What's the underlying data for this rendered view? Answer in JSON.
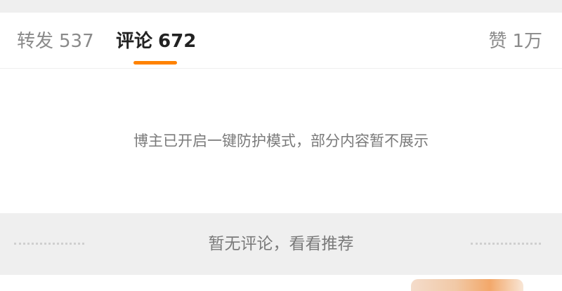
{
  "tabs": {
    "repost": {
      "label": "转发",
      "count": "537"
    },
    "comments": {
      "label": "评论",
      "count": "672"
    },
    "likes": {
      "label": "赞",
      "count": "1万"
    }
  },
  "notice": "博主已开启一键防护模式，部分内容暂不展示",
  "recommend": {
    "text": "暂无评论，看看推荐"
  },
  "colors": {
    "accent": "#ff8200",
    "background": "#efefef",
    "card": "#ffffff",
    "active_text": "#222222",
    "muted_text": "#8a8a8a"
  }
}
